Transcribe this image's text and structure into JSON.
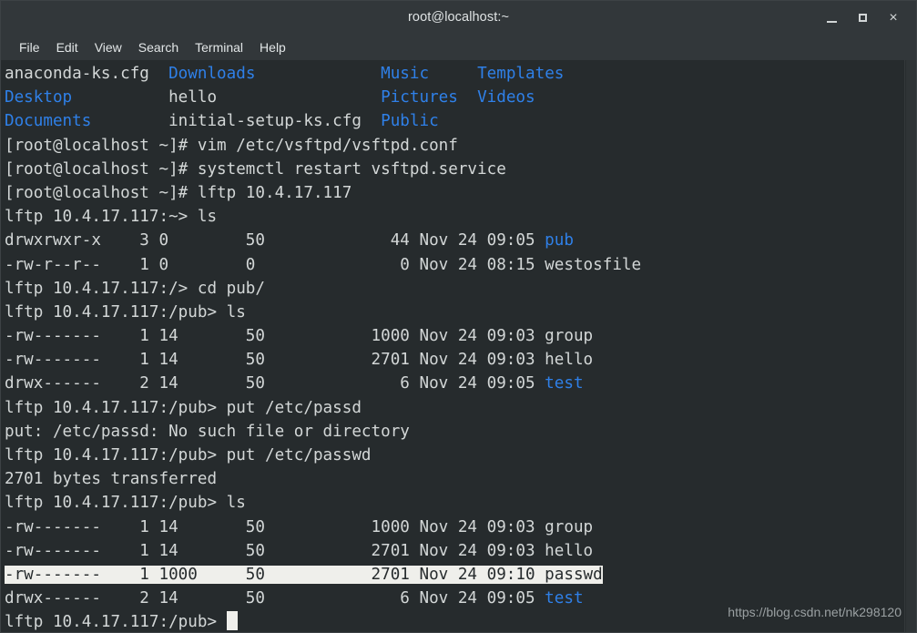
{
  "window": {
    "title": "root@localhost:~",
    "buttons": {
      "minimize": "minimize",
      "maximize": "maximize",
      "close": "×"
    }
  },
  "menubar": {
    "items": [
      {
        "label": "File"
      },
      {
        "label": "Edit"
      },
      {
        "label": "View"
      },
      {
        "label": "Search"
      },
      {
        "label": "Terminal"
      },
      {
        "label": "Help"
      }
    ]
  },
  "colors": {
    "background": "#262b2d",
    "foreground": "#d3d7d7",
    "directory_blue": "#2f80e8",
    "selection_bg": "#efefeb",
    "selection_fg": "#262b2d",
    "chrome": "#32373a"
  },
  "terminal": {
    "lines": [
      {
        "id": "l01",
        "segments": [
          {
            "text": "anaconda-ks.cfg  ",
            "color": "white"
          },
          {
            "text": "Downloads",
            "color": "blue"
          },
          {
            "text": "             ",
            "color": "white"
          },
          {
            "text": "Music",
            "color": "blue"
          },
          {
            "text": "     ",
            "color": "white"
          },
          {
            "text": "Templates",
            "color": "blue"
          }
        ]
      },
      {
        "id": "l02",
        "segments": [
          {
            "text": "Desktop",
            "color": "blue"
          },
          {
            "text": "          hello                 ",
            "color": "white"
          },
          {
            "text": "Pictures",
            "color": "blue"
          },
          {
            "text": "  ",
            "color": "white"
          },
          {
            "text": "Videos",
            "color": "blue"
          }
        ]
      },
      {
        "id": "l03",
        "segments": [
          {
            "text": "Documents",
            "color": "blue"
          },
          {
            "text": "        initial-setup-ks.cfg  ",
            "color": "white"
          },
          {
            "text": "Public",
            "color": "blue"
          }
        ]
      },
      {
        "id": "l04",
        "segments": [
          {
            "text": "[root@localhost ~]# vim /etc/vsftpd/vsftpd.conf",
            "color": "white"
          }
        ]
      },
      {
        "id": "l05",
        "segments": [
          {
            "text": "[root@localhost ~]# systemctl restart vsftpd.service",
            "color": "white"
          }
        ]
      },
      {
        "id": "l06",
        "segments": [
          {
            "text": "[root@localhost ~]# lftp 10.4.17.117",
            "color": "white"
          }
        ]
      },
      {
        "id": "l07",
        "segments": [
          {
            "text": "lftp 10.4.17.117:~> ls",
            "color": "white"
          }
        ]
      },
      {
        "id": "l08",
        "segments": [
          {
            "text": "drwxrwxr-x    3 0        50             44 Nov 24 09:05 ",
            "color": "white"
          },
          {
            "text": "pub",
            "color": "blue"
          }
        ]
      },
      {
        "id": "l09",
        "segments": [
          {
            "text": "-rw-r--r--    1 0        0               0 Nov 24 08:15 westosfile",
            "color": "white"
          }
        ]
      },
      {
        "id": "l10",
        "segments": [
          {
            "text": "lftp 10.4.17.117:/> cd pub/",
            "color": "white"
          }
        ]
      },
      {
        "id": "l11",
        "segments": [
          {
            "text": "lftp 10.4.17.117:/pub> ls",
            "color": "white"
          }
        ]
      },
      {
        "id": "l12",
        "segments": [
          {
            "text": "-rw-------    1 14       50           1000 Nov 24 09:03 group",
            "color": "white"
          }
        ]
      },
      {
        "id": "l13",
        "segments": [
          {
            "text": "-rw-------    1 14       50           2701 Nov 24 09:03 hello",
            "color": "white"
          }
        ]
      },
      {
        "id": "l14",
        "segments": [
          {
            "text": "drwx------    2 14       50              6 Nov 24 09:05 ",
            "color": "white"
          },
          {
            "text": "test",
            "color": "blue"
          }
        ]
      },
      {
        "id": "l15",
        "segments": [
          {
            "text": "lftp 10.4.17.117:/pub> put /etc/passd",
            "color": "white"
          }
        ]
      },
      {
        "id": "l16",
        "segments": [
          {
            "text": "put: /etc/passd: No such file or directory",
            "color": "white"
          }
        ]
      },
      {
        "id": "l17",
        "segments": [
          {
            "text": "lftp 10.4.17.117:/pub> put /etc/passwd",
            "color": "white"
          }
        ]
      },
      {
        "id": "l18",
        "segments": [
          {
            "text": "2701 bytes transferred",
            "color": "white"
          }
        ]
      },
      {
        "id": "l19",
        "segments": [
          {
            "text": "lftp 10.4.17.117:/pub> ls",
            "color": "white"
          }
        ]
      },
      {
        "id": "l20",
        "segments": [
          {
            "text": "-rw-------    1 14       50           1000 Nov 24 09:03 group",
            "color": "white"
          }
        ]
      },
      {
        "id": "l21",
        "segments": [
          {
            "text": "-rw-------    1 14       50           2701 Nov 24 09:03 hello",
            "color": "white"
          }
        ]
      },
      {
        "id": "l22",
        "segments": [
          {
            "text": "-rw-------    1 1000     50           2701 Nov 24 09:10 passwd",
            "color": "selected"
          }
        ]
      },
      {
        "id": "l23",
        "segments": [
          {
            "text": "drwx------    2 14       50              6 Nov 24 09:05 ",
            "color": "white"
          },
          {
            "text": "test",
            "color": "blue"
          }
        ]
      },
      {
        "id": "l24",
        "segments": [
          {
            "text": "lftp 10.4.17.117:/pub> ",
            "color": "white"
          },
          {
            "text": "",
            "color": "cursor"
          }
        ]
      }
    ]
  },
  "watermark": {
    "text": "https://blog.csdn.net/nk298120"
  }
}
